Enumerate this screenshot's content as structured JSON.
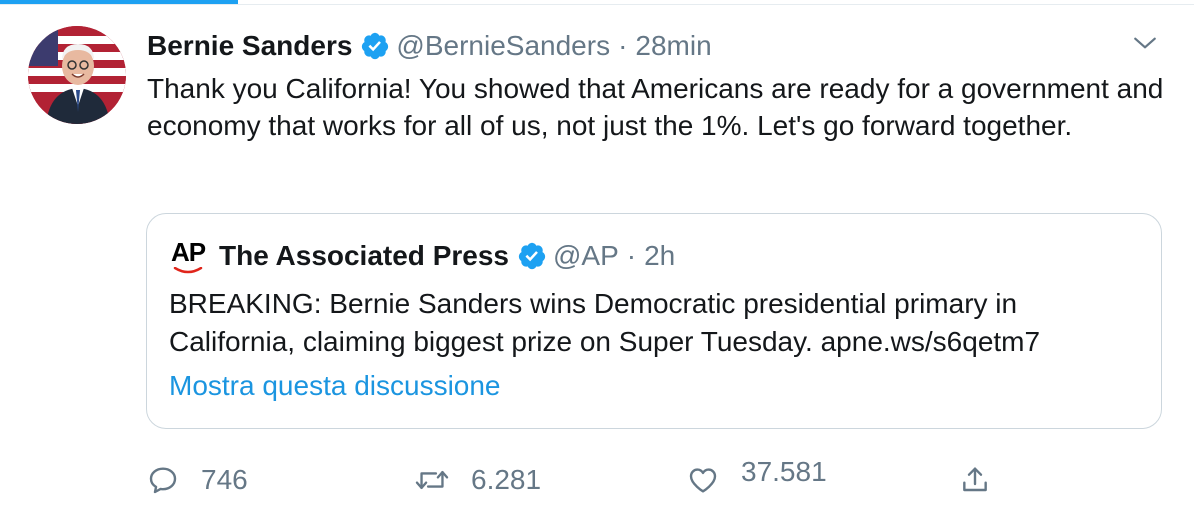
{
  "tweet": {
    "author_name": "Bernie Sanders",
    "handle": "@BernieSanders",
    "separator": "·",
    "time": "28min",
    "text": "Thank you California! You showed that Americans are ready for a government and economy that works for all of us, not just the 1%. Let's go forward together."
  },
  "quote": {
    "logo_text": "AP",
    "author_name": "The Associated Press",
    "handle": "@AP",
    "separator": "·",
    "time": "2h",
    "text": "BREAKING: Bernie Sanders wins Democratic presidential primary in California, claiming biggest prize on Super Tuesday. apne.ws/s6qetm7",
    "show_thread": "Mostra questa discussione"
  },
  "actions": {
    "replies": "746",
    "retweets": "6.281",
    "likes": "37.581"
  },
  "colors": {
    "accent": "#1da1f2",
    "link": "#1b95e0",
    "muted": "#657786",
    "border": "#ccd6dd"
  },
  "icons": [
    "verified-icon",
    "chevron-down-icon",
    "reply-icon",
    "retweet-icon",
    "like-icon",
    "share-icon"
  ]
}
